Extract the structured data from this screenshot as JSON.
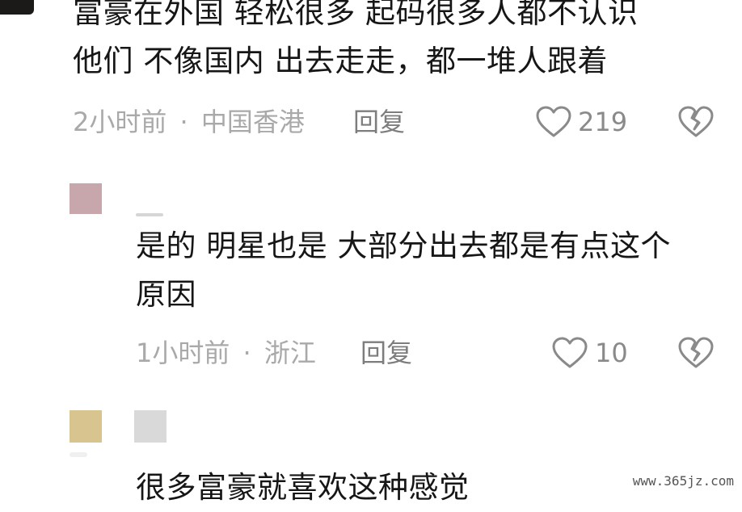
{
  "comments": [
    {
      "lines": [
        "富豪在外国  轻松很多  起码很多人都不认识",
        "他们  不像国内  出去走走，都一堆人跟着"
      ],
      "time": "2小时前",
      "location": "中国香港",
      "reply_label": "回复",
      "likes": "219"
    },
    {
      "lines": [
        "是的 明星也是 大部分出去都是有点这个",
        "原因"
      ],
      "time": "1小时前",
      "location": "浙江",
      "reply_label": "回复",
      "likes": "10"
    },
    {
      "lines": [
        "很多富豪就喜欢这种感觉"
      ]
    }
  ],
  "separator": "·",
  "watermark": "www.365jz.com",
  "icons": {
    "like": "heart-outline-icon",
    "dislike": "broken-heart-icon"
  },
  "colors": {
    "text": "#161616",
    "meta": "#a9a9a9",
    "icon": "#8a8a8a",
    "avatar_1": "#c8a7ac",
    "avatar_2": "#d8c48e",
    "avatar_3": "#d9d9d9"
  }
}
